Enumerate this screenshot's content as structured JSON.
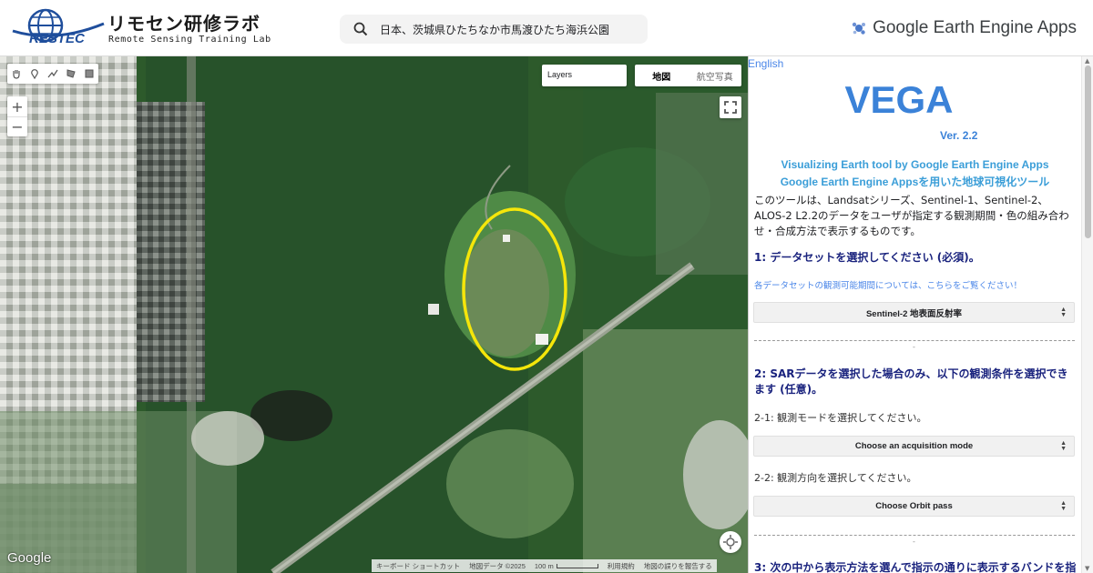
{
  "header": {
    "logo_text": "RESTEC",
    "site_title": "リモセン研修ラボ",
    "site_subtitle": "Remote Sensing Training Lab",
    "search_value": "日本、茨城県ひたちなか市馬渡ひたち海浜公園",
    "app_title": "Google Earth Engine Apps"
  },
  "map": {
    "layers_label": "Layers",
    "map_types": [
      "地図",
      "航空写真"
    ],
    "active_map_type": "地図",
    "zoom_in": "+",
    "zoom_out": "−",
    "google_label": "Google",
    "attribution": {
      "shortcuts": "キーボード ショートカット",
      "map_data": "地図データ ©2025",
      "scale": "100 m",
      "terms": "利用規約",
      "report": "地図の誤りを報告する"
    },
    "highlight_color": "#f5e60a",
    "draw_tools": [
      "hand-icon",
      "marker-icon",
      "line-icon",
      "polygon-icon",
      "rectangle-icon"
    ]
  },
  "panel": {
    "language_link": "English",
    "app_name": "VEGA",
    "version": "Ver. 2.2",
    "tagline_en": "Visualizing Earth tool by Google Earth Engine Apps",
    "tagline_ja": "Google Earth Engine Appsを用いた地球可視化ツール",
    "intro": "このツールは、Landsatシリーズ、Sentinel-1、Sentinel-2、ALOS-2 L2.2のデータをユーザが指定する観測期間・色の組み合わせ・合成方法で表示するものです。",
    "step1": {
      "title": "1: データセットを選択してください (必須)。",
      "note": "各データセットの観測可能期間については、こちらをご覧ください！",
      "dataset_select": "Sentinel-2 地表面反射率"
    },
    "step2": {
      "title": "2: SARデータを選択した場合のみ、以下の観測条件を選択できます (任意)。",
      "mode_label": "2-1: 観測モードを選択してください。",
      "mode_select": "Choose an acquisition mode",
      "orbit_label": "2-2: 観測方向を選択してください。",
      "orbit_select": "Choose Orbit pass"
    },
    "step3": {
      "title": "3: 次の中から表示方法を選んで指示の通りに表示するバンドを指"
    },
    "divider_mark": "-",
    "accent_color": "#3b82d8"
  }
}
